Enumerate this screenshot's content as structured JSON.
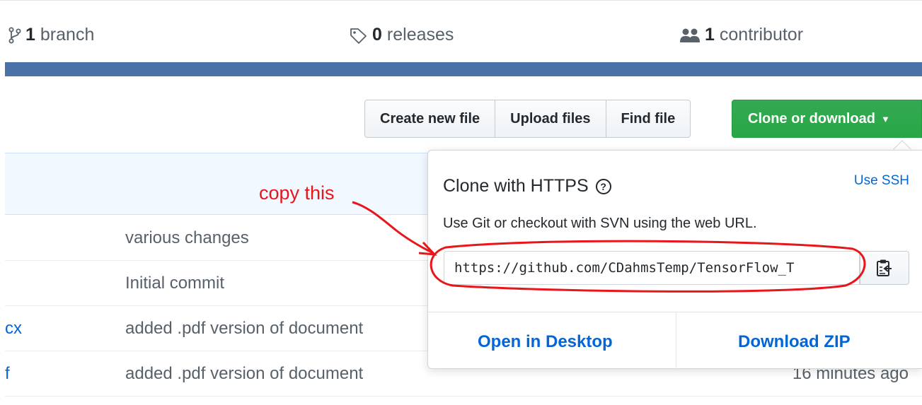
{
  "stats": {
    "branch": {
      "count": "1",
      "label": "branch",
      "icon": "git-branch-icon"
    },
    "releases": {
      "count": "0",
      "label": "releases",
      "icon": "tag-icon"
    },
    "contributors": {
      "count": "1",
      "label": "contributor",
      "icon": "people-icon"
    }
  },
  "toolbar": {
    "create_new_file": "Create new file",
    "upload_files": "Upload files",
    "find_file": "Find file",
    "clone_or_download": "Clone or download"
  },
  "files": [
    {
      "name": "",
      "message": "various changes",
      "age": ""
    },
    {
      "name": "",
      "message": "Initial commit",
      "age": ""
    },
    {
      "name": "cx",
      "message": "added .pdf version of document",
      "age": ""
    },
    {
      "name": "f",
      "message": "added .pdf version of document",
      "age": "16 minutes ago"
    }
  ],
  "clone_panel": {
    "title": "Clone with HTTPS",
    "help_glyph": "?",
    "use_ssh": "Use SSH",
    "description": "Use Git or checkout with SVN using the web URL.",
    "url": "https://github.com/CDahmsTemp/TensorFlow_T",
    "open_in_desktop": "Open in Desktop",
    "download_zip": "Download ZIP"
  },
  "annotation": {
    "text": "copy this",
    "color": "#e8161b"
  },
  "colors": {
    "accent_blue": "#0366d6",
    "clone_green": "#28a745",
    "language_bar": "#4b72a8"
  }
}
